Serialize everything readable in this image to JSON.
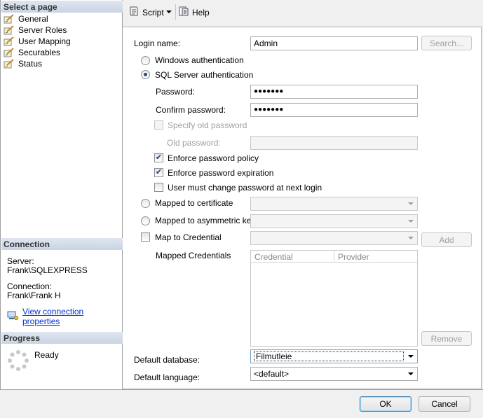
{
  "left": {
    "select_header": "Select a page",
    "pages": [
      {
        "label": "General"
      },
      {
        "label": "Server Roles"
      },
      {
        "label": "User Mapping"
      },
      {
        "label": "Securables"
      },
      {
        "label": "Status"
      }
    ],
    "connection_header": "Connection",
    "server_label": "Server:",
    "server_value": "Frank\\SQLEXPRESS",
    "connection_label": "Connection:",
    "connection_value": "Frank\\Frank H",
    "view_link": "View connection properties",
    "progress_header": "Progress",
    "progress_status": "Ready"
  },
  "toolbar": {
    "script_label": "Script",
    "help_label": "Help"
  },
  "form": {
    "login_name_label": "Login name:",
    "login_name_value": "Admin",
    "search_button": "Search...",
    "windows_auth": "Windows authentication",
    "sql_auth": "SQL Server authentication",
    "password_label": "Password:",
    "password_value": "●●●●●●●",
    "confirm_label": "Confirm password:",
    "confirm_value": "●●●●●●●",
    "specify_old": "Specify old password",
    "old_password_label": "Old password:",
    "enforce_policy": "Enforce password policy",
    "enforce_expiration": "Enforce password expiration",
    "must_change": "User must change password at next login",
    "mapped_cert": "Mapped to certificate",
    "mapped_asym": "Mapped to asymmetric key",
    "map_credential": "Map to Credential",
    "add_button": "Add",
    "mapped_credentials_label": "Mapped Credentials",
    "grid_col_credential": "Credential",
    "grid_col_provider": "Provider",
    "remove_button": "Remove",
    "default_db_label": "Default database:",
    "default_db_value": "Filmutleie",
    "default_lang_label": "Default language:",
    "default_lang_value": "<default>"
  },
  "footer": {
    "ok_button": "OK",
    "cancel_button": "Cancel"
  }
}
